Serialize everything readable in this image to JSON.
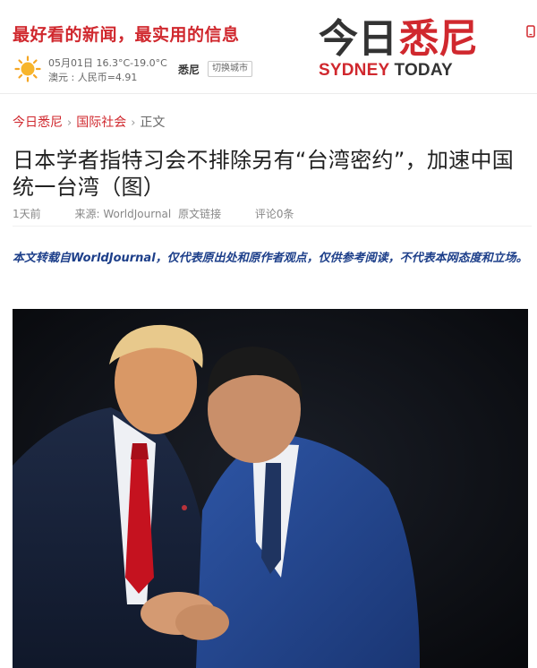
{
  "header": {
    "slogan": "最好看的新闻，最实用的信息",
    "weather": {
      "icon": "sun-icon",
      "date_temp": "05月01日 16.3°C-19.0°C",
      "currency": "澳元 : 人民币=4.91"
    },
    "city": "悉尼",
    "city_switch": "切换城市",
    "logo": {
      "cn_part1": "今日",
      "cn_part2": "悉尼",
      "en_part1": "SYDNEY",
      "en_part2": "TODAY"
    },
    "colors": {
      "brand_red": "#d0282e",
      "dark": "#333333",
      "navy": "#1d3f8a"
    }
  },
  "breadcrumb": [
    {
      "label": "今日悉尼"
    },
    {
      "label": "国际社会"
    },
    {
      "label": "正文"
    }
  ],
  "article": {
    "title": "日本学者指特习会不排除另有“台湾密约”，加速中国统一台湾（图）",
    "time": "1天前",
    "source_label": "来源:",
    "source": "WorldJournal",
    "source_link": "原文链接",
    "comments": "评论0条",
    "disclaimer": "本文转载自WorldJournal，仅代表原出处和原作者观点，仅供参考阅读，不代表本网态度和立场。"
  }
}
